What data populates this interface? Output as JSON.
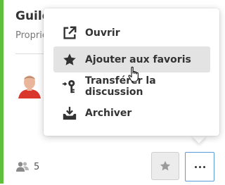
{
  "card": {
    "title": "Guild",
    "subtitle": "Propriét",
    "member_count": "5",
    "accent_color": "#5fc13b"
  },
  "menu": {
    "items": [
      {
        "label": "Ouvrir",
        "icon": "external-link-icon"
      },
      {
        "label": "Ajouter aux favoris",
        "icon": "star-icon"
      },
      {
        "label": "Transférer la discussion",
        "icon": "key-transfer-icon"
      },
      {
        "label": "Archiver",
        "icon": "archive-icon"
      }
    ],
    "hovered_index": 1
  },
  "actions": {
    "favorite_icon": "star-icon",
    "more_icon": "ellipsis-icon"
  }
}
